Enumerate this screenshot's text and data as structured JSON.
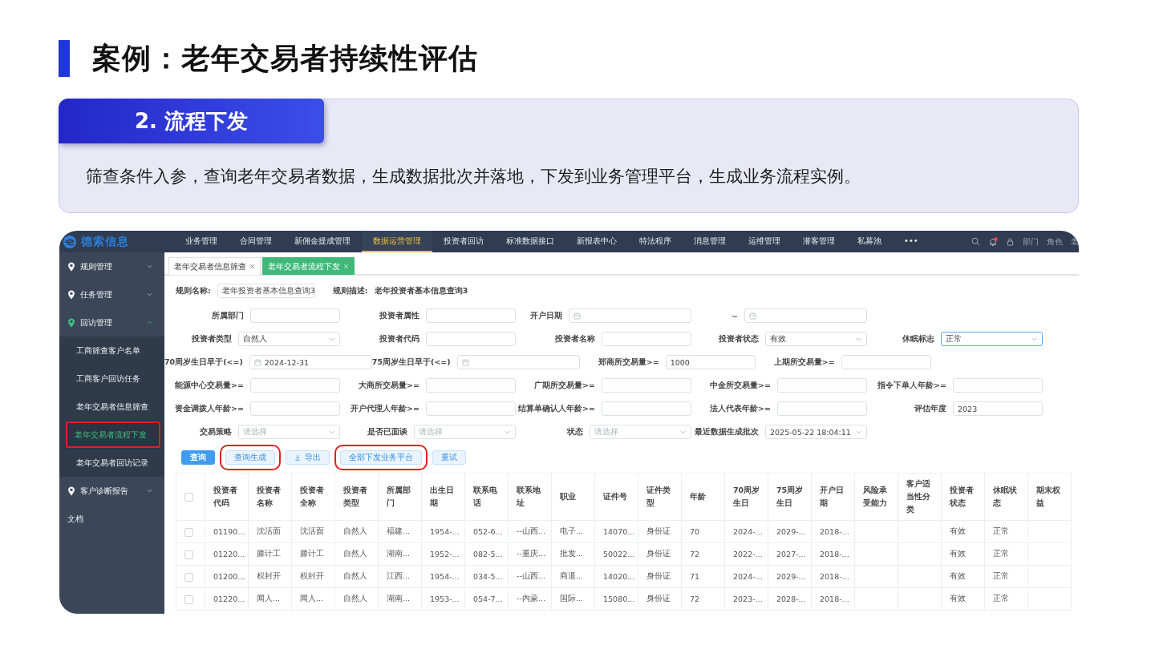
{
  "slide": {
    "title": "案例：老年交易者持续性评估",
    "section": {
      "heading": "2. 流程下发",
      "description": "筛查条件入参，查询老年交易者数据，生成数据批次并落地，下发到业务管理平台，生成业务流程实例。"
    }
  },
  "app": {
    "brand": "德索信息",
    "nav": [
      {
        "label": "业务管理",
        "selected": false
      },
      {
        "label": "合同管理",
        "selected": false
      },
      {
        "label": "新佣金提成管理",
        "selected": false
      },
      {
        "label": "数据运营管理",
        "selected": true
      },
      {
        "label": "投资者回访",
        "selected": false
      },
      {
        "label": "标准数据接口",
        "selected": false
      },
      {
        "label": "新报表中心",
        "selected": false
      },
      {
        "label": "特法程序",
        "selected": false
      },
      {
        "label": "消息管理",
        "selected": false
      },
      {
        "label": "运维管理",
        "selected": false
      },
      {
        "label": "潜客管理",
        "selected": false
      },
      {
        "label": "私募池",
        "selected": false
      },
      {
        "label": "•••",
        "selected": false
      }
    ],
    "notification": {
      "unread": true
    },
    "header_links": [
      "部门",
      "角色",
      "老"
    ],
    "sidebar": [
      {
        "label": "规则管理",
        "kind": "menu",
        "expanded": false
      },
      {
        "label": "任务管理",
        "kind": "menu",
        "expanded": false
      },
      {
        "label": "回访管理",
        "kind": "menu",
        "expanded": true,
        "children": [
          {
            "label": "工商筛查客户名单",
            "selected": false,
            "highlighted": false
          },
          {
            "label": "工商客户回访任务",
            "selected": false,
            "highlighted": false
          },
          {
            "label": "老年交易者信息筛查",
            "selected": false,
            "highlighted": false
          },
          {
            "label": "老年交易者流程下发",
            "selected": true,
            "highlighted": true
          },
          {
            "label": "老年交易者回访记录",
            "selected": false,
            "highlighted": false
          }
        ]
      },
      {
        "label": "客户诊断报告",
        "kind": "menu",
        "expanded": false
      },
      {
        "label": "文档",
        "kind": "link"
      }
    ],
    "tabs": [
      {
        "label": "老年交易者信息筛查",
        "selected": false
      },
      {
        "label": "老年交易者流程下发",
        "selected": true
      }
    ],
    "rule": {
      "name_label": "规则名称:",
      "name_value": "老年投资者基本信息查询3",
      "desc_label": "规则描述:",
      "desc_value": "老年投资者基本信息查询3"
    },
    "filters": [
      [
        {
          "label": "所属部门",
          "kind": "text"
        },
        {
          "label": "投资者属性",
          "kind": "text"
        },
        {
          "label": "开户日期",
          "kind": "date"
        },
        {
          "label": "~",
          "kind": "date"
        }
      ],
      [
        {
          "label": "投资者类型",
          "kind": "select",
          "value": "自然人"
        },
        {
          "label": "投资者代码",
          "kind": "text"
        },
        {
          "label": "投资者名称",
          "kind": "text"
        },
        {
          "label": "投资者状态",
          "kind": "select",
          "value": "有效"
        },
        {
          "label": "休眠标志",
          "kind": "select",
          "value": "正常",
          "focused": true
        }
      ],
      [
        {
          "label": "70周岁生日早于(<=)",
          "kind": "date",
          "value": "2024-12-31"
        },
        {
          "label": "75周岁生日早于(<=)",
          "kind": "date"
        },
        {
          "label": "郑商所交易量>=",
          "kind": "text",
          "value": "1000"
        },
        {
          "label": "上期所交易量>=",
          "kind": "text"
        }
      ],
      [
        {
          "label": "能源中心交易量>=",
          "kind": "text"
        },
        {
          "label": "大商所交易量>=",
          "kind": "text"
        },
        {
          "label": "广期所交易量>=",
          "kind": "text"
        },
        {
          "label": "中金所交易量>=",
          "kind": "text"
        },
        {
          "label": "指令下单人年龄>=",
          "kind": "text"
        }
      ],
      [
        {
          "label": "资金调拨人年龄>=",
          "kind": "text"
        },
        {
          "label": "开户代理人年龄>=",
          "kind": "text"
        },
        {
          "label": "结算单确认人年龄>=",
          "kind": "text"
        },
        {
          "label": "法人代表年龄>=",
          "kind": "text"
        },
        {
          "label": "评估年度",
          "kind": "text",
          "value": "2023"
        }
      ],
      [
        {
          "label": "交易策略",
          "kind": "select",
          "placeholder": "请选择"
        },
        {
          "label": "是否已面谈",
          "kind": "select",
          "placeholder": "请选择"
        },
        {
          "label": "状态",
          "kind": "select",
          "placeholder": "请选择"
        },
        {
          "label": "最近数据生成批次",
          "kind": "select",
          "value": "2025-05-22 18:04:11"
        }
      ]
    ],
    "buttons": [
      {
        "label": "查询",
        "kind": "primary",
        "highlighted": false
      },
      {
        "label": "查询生成",
        "kind": "plain",
        "highlighted": true
      },
      {
        "label": "导出",
        "kind": "export",
        "highlighted": false
      },
      {
        "label": "全部下发业务平台",
        "kind": "plain",
        "highlighted": true
      },
      {
        "label": "重试",
        "kind": "plain",
        "highlighted": false
      }
    ],
    "table": {
      "header_checked": false,
      "columns": [
        "投资者代码",
        "投资者名称",
        "投资者全称",
        "投资者类型",
        "所属部门",
        "出生日期",
        "联系电话",
        "联系地址",
        "职业",
        "证件号",
        "证件类型",
        "年龄",
        "70周岁生日",
        "75周岁生日",
        "开户日期",
        "风险承受能力",
        "客户适当性分类",
        "投资者状态",
        "休眠状态",
        "期末权益"
      ],
      "rows": [
        {
          "checked": false,
          "cells": [
            "01190...",
            "沈活面",
            "沈活面",
            "自然人",
            "福建...",
            "1954-...",
            "052-6...",
            "--山西...",
            "电子...",
            "14070...",
            "身份证",
            "70",
            "2024-...",
            "2029-...",
            "2018-...",
            null,
            null,
            "有效",
            "正常",
            null
          ]
        },
        {
          "checked": false,
          "cells": [
            "01220...",
            "滕计工",
            "滕计工",
            "自然人",
            "湖南...",
            "1952-...",
            "082-5...",
            "--重庆...",
            "批发...",
            "50022...",
            "身份证",
            "72",
            "2022-...",
            "2027-...",
            "2018-...",
            null,
            null,
            "有效",
            "正常",
            null
          ]
        },
        {
          "checked": false,
          "cells": [
            "01200...",
            "权封开",
            "权封开",
            "自然人",
            "江西...",
            "1954-...",
            "034-5...",
            "--山西...",
            "商退...",
            "14020...",
            "身份证",
            "71",
            "2024-...",
            "2029-...",
            "2018-...",
            null,
            null,
            "有效",
            "正常",
            null
          ]
        },
        {
          "checked": false,
          "cells": [
            "01220...",
            "闻人...",
            "闻人...",
            "自然人",
            "湖南...",
            "1953-...",
            "054-7...",
            "--内蒙...",
            "国际...",
            "15080...",
            "身份证",
            "72",
            "2023-...",
            "2028-...",
            "2018-...",
            null,
            null,
            "有效",
            "正常",
            null
          ]
        }
      ]
    }
  }
}
